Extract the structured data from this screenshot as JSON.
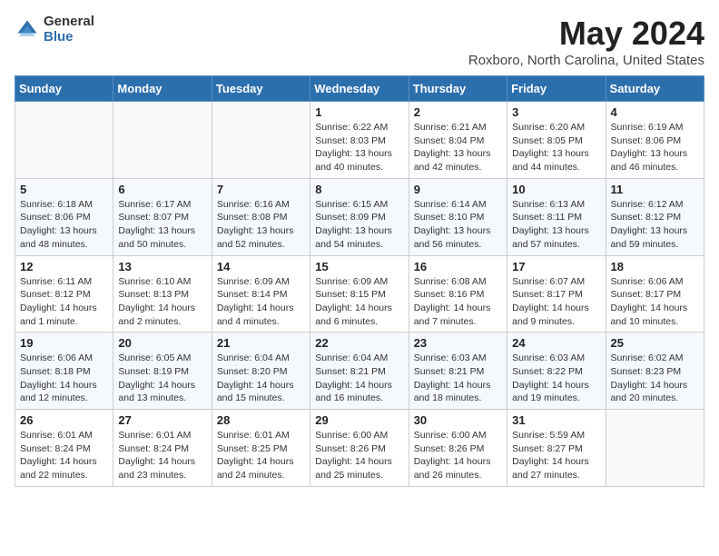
{
  "header": {
    "logo_general": "General",
    "logo_blue": "Blue",
    "month_year": "May 2024",
    "location": "Roxboro, North Carolina, United States"
  },
  "days_of_week": [
    "Sunday",
    "Monday",
    "Tuesday",
    "Wednesday",
    "Thursday",
    "Friday",
    "Saturday"
  ],
  "weeks": [
    [
      {
        "day": "",
        "sunrise": "",
        "sunset": "",
        "daylight": ""
      },
      {
        "day": "",
        "sunrise": "",
        "sunset": "",
        "daylight": ""
      },
      {
        "day": "",
        "sunrise": "",
        "sunset": "",
        "daylight": ""
      },
      {
        "day": "1",
        "sunrise": "Sunrise: 6:22 AM",
        "sunset": "Sunset: 8:03 PM",
        "daylight": "Daylight: 13 hours and 40 minutes."
      },
      {
        "day": "2",
        "sunrise": "Sunrise: 6:21 AM",
        "sunset": "Sunset: 8:04 PM",
        "daylight": "Daylight: 13 hours and 42 minutes."
      },
      {
        "day": "3",
        "sunrise": "Sunrise: 6:20 AM",
        "sunset": "Sunset: 8:05 PM",
        "daylight": "Daylight: 13 hours and 44 minutes."
      },
      {
        "day": "4",
        "sunrise": "Sunrise: 6:19 AM",
        "sunset": "Sunset: 8:06 PM",
        "daylight": "Daylight: 13 hours and 46 minutes."
      }
    ],
    [
      {
        "day": "5",
        "sunrise": "Sunrise: 6:18 AM",
        "sunset": "Sunset: 8:06 PM",
        "daylight": "Daylight: 13 hours and 48 minutes."
      },
      {
        "day": "6",
        "sunrise": "Sunrise: 6:17 AM",
        "sunset": "Sunset: 8:07 PM",
        "daylight": "Daylight: 13 hours and 50 minutes."
      },
      {
        "day": "7",
        "sunrise": "Sunrise: 6:16 AM",
        "sunset": "Sunset: 8:08 PM",
        "daylight": "Daylight: 13 hours and 52 minutes."
      },
      {
        "day": "8",
        "sunrise": "Sunrise: 6:15 AM",
        "sunset": "Sunset: 8:09 PM",
        "daylight": "Daylight: 13 hours and 54 minutes."
      },
      {
        "day": "9",
        "sunrise": "Sunrise: 6:14 AM",
        "sunset": "Sunset: 8:10 PM",
        "daylight": "Daylight: 13 hours and 56 minutes."
      },
      {
        "day": "10",
        "sunrise": "Sunrise: 6:13 AM",
        "sunset": "Sunset: 8:11 PM",
        "daylight": "Daylight: 13 hours and 57 minutes."
      },
      {
        "day": "11",
        "sunrise": "Sunrise: 6:12 AM",
        "sunset": "Sunset: 8:12 PM",
        "daylight": "Daylight: 13 hours and 59 minutes."
      }
    ],
    [
      {
        "day": "12",
        "sunrise": "Sunrise: 6:11 AM",
        "sunset": "Sunset: 8:12 PM",
        "daylight": "Daylight: 14 hours and 1 minute."
      },
      {
        "day": "13",
        "sunrise": "Sunrise: 6:10 AM",
        "sunset": "Sunset: 8:13 PM",
        "daylight": "Daylight: 14 hours and 2 minutes."
      },
      {
        "day": "14",
        "sunrise": "Sunrise: 6:09 AM",
        "sunset": "Sunset: 8:14 PM",
        "daylight": "Daylight: 14 hours and 4 minutes."
      },
      {
        "day": "15",
        "sunrise": "Sunrise: 6:09 AM",
        "sunset": "Sunset: 8:15 PM",
        "daylight": "Daylight: 14 hours and 6 minutes."
      },
      {
        "day": "16",
        "sunrise": "Sunrise: 6:08 AM",
        "sunset": "Sunset: 8:16 PM",
        "daylight": "Daylight: 14 hours and 7 minutes."
      },
      {
        "day": "17",
        "sunrise": "Sunrise: 6:07 AM",
        "sunset": "Sunset: 8:17 PM",
        "daylight": "Daylight: 14 hours and 9 minutes."
      },
      {
        "day": "18",
        "sunrise": "Sunrise: 6:06 AM",
        "sunset": "Sunset: 8:17 PM",
        "daylight": "Daylight: 14 hours and 10 minutes."
      }
    ],
    [
      {
        "day": "19",
        "sunrise": "Sunrise: 6:06 AM",
        "sunset": "Sunset: 8:18 PM",
        "daylight": "Daylight: 14 hours and 12 minutes."
      },
      {
        "day": "20",
        "sunrise": "Sunrise: 6:05 AM",
        "sunset": "Sunset: 8:19 PM",
        "daylight": "Daylight: 14 hours and 13 minutes."
      },
      {
        "day": "21",
        "sunrise": "Sunrise: 6:04 AM",
        "sunset": "Sunset: 8:20 PM",
        "daylight": "Daylight: 14 hours and 15 minutes."
      },
      {
        "day": "22",
        "sunrise": "Sunrise: 6:04 AM",
        "sunset": "Sunset: 8:21 PM",
        "daylight": "Daylight: 14 hours and 16 minutes."
      },
      {
        "day": "23",
        "sunrise": "Sunrise: 6:03 AM",
        "sunset": "Sunset: 8:21 PM",
        "daylight": "Daylight: 14 hours and 18 minutes."
      },
      {
        "day": "24",
        "sunrise": "Sunrise: 6:03 AM",
        "sunset": "Sunset: 8:22 PM",
        "daylight": "Daylight: 14 hours and 19 minutes."
      },
      {
        "day": "25",
        "sunrise": "Sunrise: 6:02 AM",
        "sunset": "Sunset: 8:23 PM",
        "daylight": "Daylight: 14 hours and 20 minutes."
      }
    ],
    [
      {
        "day": "26",
        "sunrise": "Sunrise: 6:01 AM",
        "sunset": "Sunset: 8:24 PM",
        "daylight": "Daylight: 14 hours and 22 minutes."
      },
      {
        "day": "27",
        "sunrise": "Sunrise: 6:01 AM",
        "sunset": "Sunset: 8:24 PM",
        "daylight": "Daylight: 14 hours and 23 minutes."
      },
      {
        "day": "28",
        "sunrise": "Sunrise: 6:01 AM",
        "sunset": "Sunset: 8:25 PM",
        "daylight": "Daylight: 14 hours and 24 minutes."
      },
      {
        "day": "29",
        "sunrise": "Sunrise: 6:00 AM",
        "sunset": "Sunset: 8:26 PM",
        "daylight": "Daylight: 14 hours and 25 minutes."
      },
      {
        "day": "30",
        "sunrise": "Sunrise: 6:00 AM",
        "sunset": "Sunset: 8:26 PM",
        "daylight": "Daylight: 14 hours and 26 minutes."
      },
      {
        "day": "31",
        "sunrise": "Sunrise: 5:59 AM",
        "sunset": "Sunset: 8:27 PM",
        "daylight": "Daylight: 14 hours and 27 minutes."
      },
      {
        "day": "",
        "sunrise": "",
        "sunset": "",
        "daylight": ""
      }
    ]
  ]
}
